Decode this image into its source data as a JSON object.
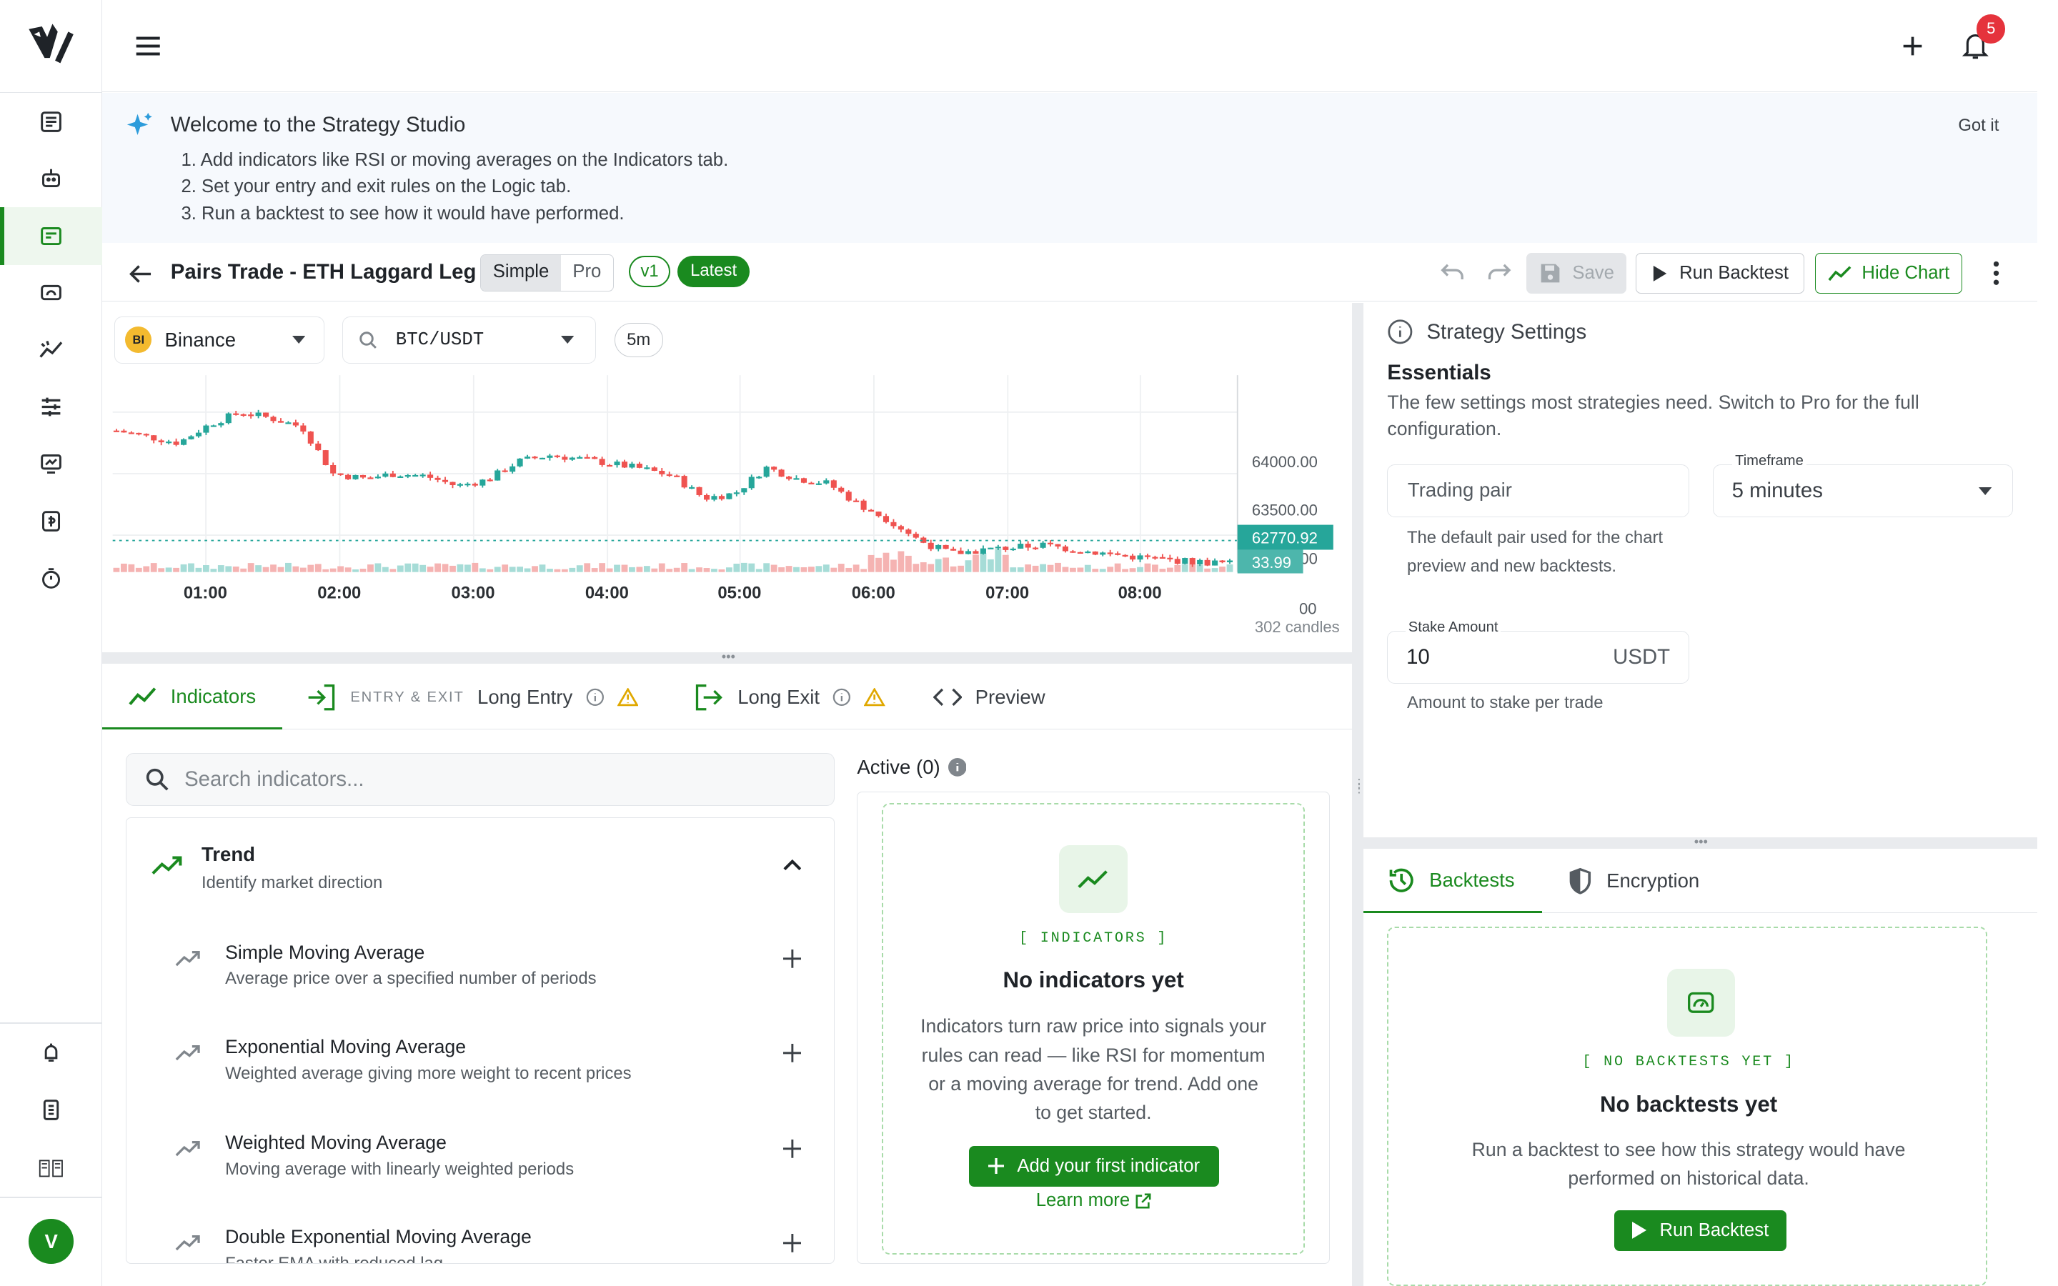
{
  "topbar": {
    "notification_count": "5"
  },
  "banner": {
    "title": "Welcome to the Strategy Studio",
    "steps": [
      "1. Add indicators like RSI or moving averages on the Indicators tab.",
      "2. Set your entry and exit rules on the Logic tab.",
      "3. Run a backtest to see how it would have performed."
    ],
    "dismiss": "Got it"
  },
  "header": {
    "title": "Pairs Trade - ETH Laggard Leg",
    "mode_simple": "Simple",
    "mode_pro": "Pro",
    "version": "v1",
    "latest": "Latest",
    "save": "Save",
    "run_backtest": "Run Backtest",
    "hide_chart": "Hide Chart"
  },
  "chart": {
    "exchange": "Binance",
    "exchange_logo": "BI",
    "pair": "BTC/USDT",
    "timeframe": "5m",
    "candles_count": "302 candles",
    "price_label": "62770.92",
    "volume_label": "33.99",
    "y_ticks": [
      "64000.00",
      "63500.00",
      "63000.00",
      "00"
    ],
    "x_ticks": [
      "01:00",
      "02:00",
      "03:00",
      "04:00",
      "05:00",
      "06:00",
      "07:00",
      "08:00"
    ]
  },
  "chart_data": {
    "type": "candlestick",
    "ylim": [
      62700,
      64300
    ],
    "y_ticks": [
      64000,
      63500,
      63000
    ],
    "last_price": 62770.92,
    "last_volume": 33.99,
    "colors": {
      "up": "#26a69a",
      "down": "#ef5350"
    },
    "close_path": [
      63850,
      63800,
      63750,
      63900,
      64000,
      63950,
      63880,
      63500,
      63460,
      63500,
      63480,
      63400,
      63450,
      63600,
      63650,
      63620,
      63580,
      63540,
      63480,
      63300,
      63340,
      63550,
      63460,
      63420,
      63250,
      63120,
      62950,
      62850,
      62880,
      62900,
      62920,
      62880,
      62850,
      62820,
      62800,
      62780,
      62770
    ]
  },
  "tabs": {
    "indicators": "Indicators",
    "entry_exit_caption": "ENTRY & EXIT",
    "long_entry": "Long Entry",
    "long_exit": "Long Exit",
    "preview": "Preview"
  },
  "library": {
    "search_placeholder": "Search indicators...",
    "group_title": "Trend",
    "group_subtitle": "Identify market direction",
    "items": [
      {
        "name": "Simple Moving Average",
        "desc": "Average price over a specified number of periods"
      },
      {
        "name": "Exponential Moving Average",
        "desc": "Weighted average giving more weight to recent prices"
      },
      {
        "name": "Weighted Moving Average",
        "desc": "Moving average with linearly weighted periods"
      },
      {
        "name": "Double Exponential Moving Average",
        "desc": "Faster EMA with reduced lag"
      }
    ]
  },
  "active": {
    "title": "Active (0)",
    "tag": "[ INDICATORS ]",
    "empty_title": "No indicators yet",
    "empty_body": "Indicators turn raw price into signals your rules can read — like RSI for momentum or a moving average for trend. Add one to get started.",
    "add_button": "Add your first indicator",
    "learn_more": "Learn more"
  },
  "settings": {
    "title": "Strategy Settings",
    "section": "Essentials",
    "section_desc": "The few settings most strategies need. Switch to Pro for the full configuration.",
    "pair_placeholder": "Trading pair",
    "pair_help": "The default pair used for the chart preview and new backtests.",
    "timeframe_label": "Timeframe",
    "timeframe_value": "5 minutes",
    "stake_label": "Stake Amount",
    "stake_value": "10",
    "stake_unit": "USDT",
    "stake_help": "Amount to stake per trade"
  },
  "backtests": {
    "tab_backtests": "Backtests",
    "tab_encryption": "Encryption",
    "tag": "[ NO BACKTESTS YET ]",
    "empty_title": "No backtests yet",
    "empty_body": "Run a backtest to see how this strategy would have performed on historical data.",
    "run_button": "Run Backtest"
  },
  "user": {
    "avatar_initial": "V"
  }
}
